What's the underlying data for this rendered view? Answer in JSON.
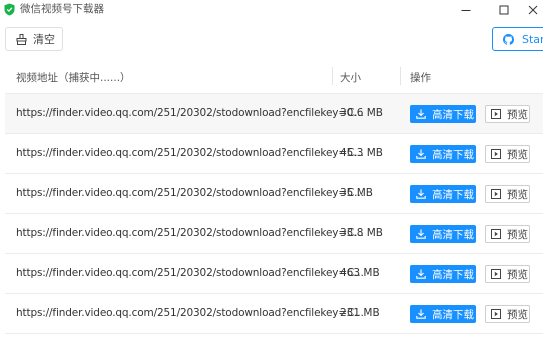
{
  "window": {
    "title": "微信视频号下载器"
  },
  "toolbar": {
    "clear_label": "清空",
    "star_label": "Star"
  },
  "table": {
    "headers": {
      "url": "视频地址（捕获中......）",
      "size": "大小",
      "action": "操作"
    },
    "rows": [
      {
        "url": "https://finder.video.qq.com/251/20302/stodownload?encfilekey=C...",
        "size": "30.6 MB",
        "download": "高清下载",
        "preview": "预览"
      },
      {
        "url": "https://finder.video.qq.com/251/20302/stodownload?encfilekey=C...",
        "size": "45.3 MB",
        "download": "高清下载",
        "preview": "预览"
      },
      {
        "url": "https://finder.video.qq.com/251/20302/stodownload?encfilekey=C...",
        "size": "35 MB",
        "download": "高清下载",
        "preview": "预览"
      },
      {
        "url": "https://finder.video.qq.com/251/20302/stodownload?encfilekey=C...",
        "size": "33.8 MB",
        "download": "高清下载",
        "preview": "预览"
      },
      {
        "url": "https://finder.video.qq.com/251/20302/stodownload?encfilekey=C...",
        "size": "463 MB",
        "download": "高清下载",
        "preview": "预览"
      },
      {
        "url": "https://finder.video.qq.com/251/20302/stodownload?encfilekey=C...",
        "size": "231 MB",
        "download": "高清下载",
        "preview": "预览"
      }
    ]
  },
  "colors": {
    "primary": "#1890ff",
    "row_shade": "#f7f7f7",
    "app_icon": "#19b34a"
  }
}
